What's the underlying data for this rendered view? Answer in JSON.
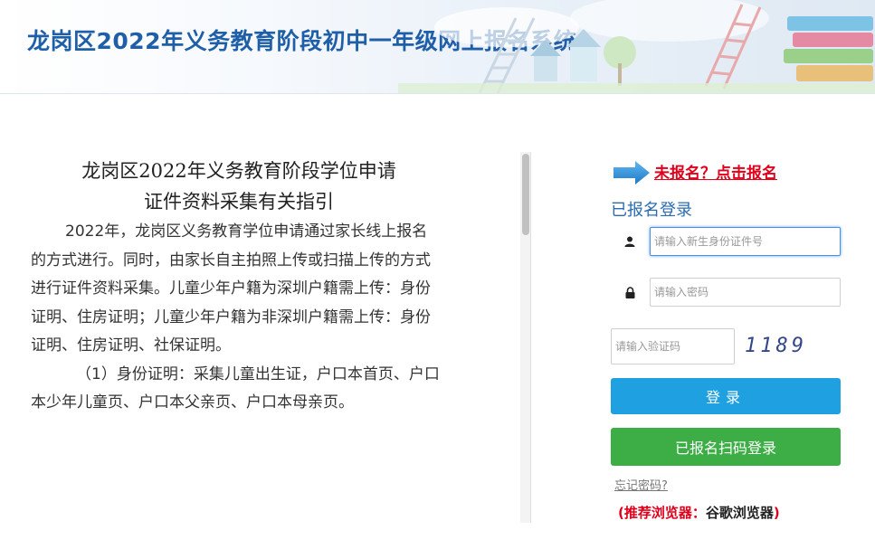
{
  "header": {
    "title": "龙岗区2022年义务教育阶段初中一年级网上报名系统",
    "colors": {
      "title": "#1f5fa8"
    }
  },
  "guide": {
    "title_line1": "龙岗区2022年义务教育阶段学位申请",
    "title_line2": "证件资料采集有关指引",
    "paragraph1": "2022年，龙岗区义务教育学位申请通过家长线上报名的方式进行。同时，由家长自主拍照上传或扫描上传的方式进行证件资料采集。儿童少年户籍为深圳户籍需上传：身份证明、住房证明；儿童少年户籍为非深圳户籍需上传：身份证明、住房证明、社保证明。",
    "paragraph2": "（1）身份证明：采集儿童出生证，户口本首页、户口本少年儿童页、户口本父亲页、户口本母亲页。"
  },
  "login": {
    "register_link": "未报名？点击报名",
    "heading": "已报名登录",
    "id_placeholder": "请输入新生身份证件号",
    "password_placeholder": "请输入密码",
    "captcha_placeholder": "请输入验证码",
    "captcha_text": "1189",
    "login_button": "登录",
    "qr_login_button": "已报名扫码登录",
    "forgot_password": "忘记密码?",
    "browser_tip_label": "(推荐浏览器：",
    "browser_tip_name": "谷歌浏览器",
    "browser_tip_end": ")",
    "colors": {
      "accent_red": "#e0001b",
      "login_blue": "#1ea0e1",
      "qr_green": "#3cae45",
      "heading_blue": "#2b6cb0"
    },
    "icons": {
      "arrow": "arrow-right-icon",
      "user": "user-icon",
      "lock": "lock-icon"
    }
  }
}
